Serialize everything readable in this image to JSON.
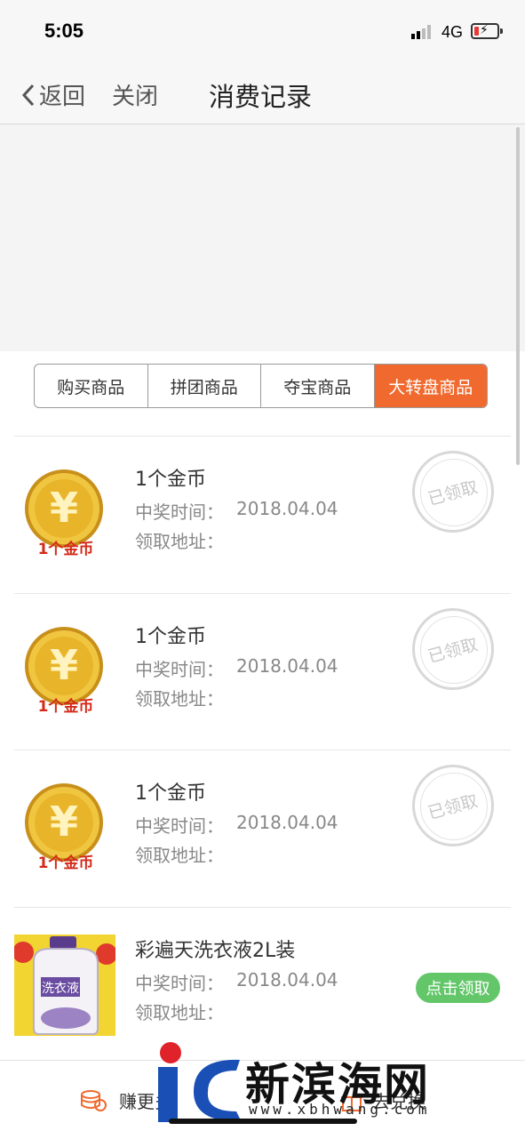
{
  "status_bar": {
    "time": "5:05",
    "network": "4G"
  },
  "nav": {
    "back_label": "返回",
    "close_label": "关闭",
    "title": "消费记录"
  },
  "tabs": [
    {
      "label": "购买商品",
      "active": false
    },
    {
      "label": "拼团商品",
      "active": false
    },
    {
      "label": "夺宝商品",
      "active": false
    },
    {
      "label": "大转盘商品",
      "active": true
    }
  ],
  "records": [
    {
      "name": "1个金币",
      "time_label": "中奖时间：",
      "time": "2018.04.04",
      "address_label": "领取地址：",
      "status": "已领取",
      "image_text": "1个金币",
      "coin_symbol": "¥"
    },
    {
      "name": "1个金币",
      "time_label": "中奖时间：",
      "time": "2018.04.04",
      "address_label": "领取地址：",
      "status": "已领取",
      "image_text": "1个金币",
      "coin_symbol": "¥"
    },
    {
      "name": "1个金币",
      "time_label": "中奖时间：",
      "time": "2018.04.04",
      "address_label": "领取地址：",
      "status": "已领取",
      "image_text": "1个金币",
      "coin_symbol": "¥"
    },
    {
      "name": "彩遍天洗衣液2L装",
      "time_label": "中奖时间：",
      "time": "2018.04.04",
      "address_label": "领取地址：",
      "action": "点击领取",
      "image_text": "洗衣液"
    }
  ],
  "footer": {
    "earn_label": "赚更多",
    "exchange_label": "去兑换"
  },
  "watermark": {
    "text": "新滨海网",
    "url": "www.xbhwang.com"
  },
  "colors": {
    "accent": "#f06a2f",
    "claim": "#63c76a",
    "coin": "#e8b52a"
  }
}
